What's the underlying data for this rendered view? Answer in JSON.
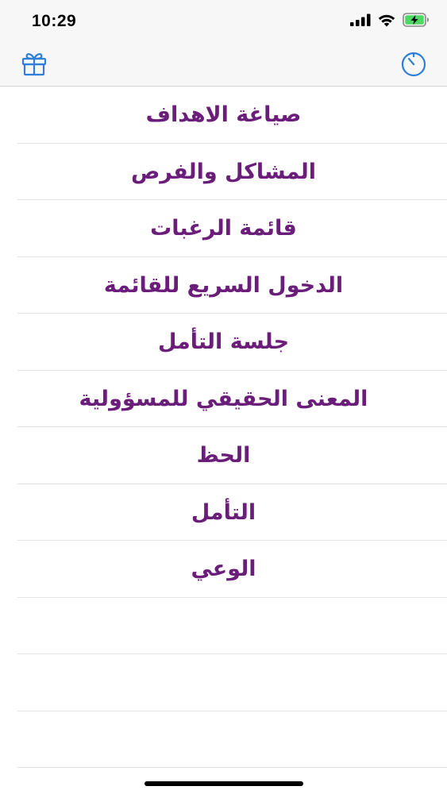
{
  "status_bar": {
    "time": "10:29",
    "icons": [
      "signal-icon",
      "wifi-icon",
      "battery-charging-icon"
    ]
  },
  "nav_bar": {
    "left_icon": "gift-icon",
    "right_icon": "timer-icon",
    "tint_color": "#2f7fd8"
  },
  "list": {
    "text_color": "#6b1d7a",
    "items": [
      {
        "label": "صياغة الاهداف"
      },
      {
        "label": "المشاكل والفرص"
      },
      {
        "label": "قائمة الرغبات"
      },
      {
        "label": "الدخول السريع للقائمة"
      },
      {
        "label": "جلسة التأمل"
      },
      {
        "label": "المعنى الحقيقي للمسؤولية"
      },
      {
        "label": "الحظ"
      },
      {
        "label": "التأمل"
      },
      {
        "label": "الوعي"
      },
      {
        "label": ""
      },
      {
        "label": ""
      },
      {
        "label": ""
      }
    ]
  }
}
